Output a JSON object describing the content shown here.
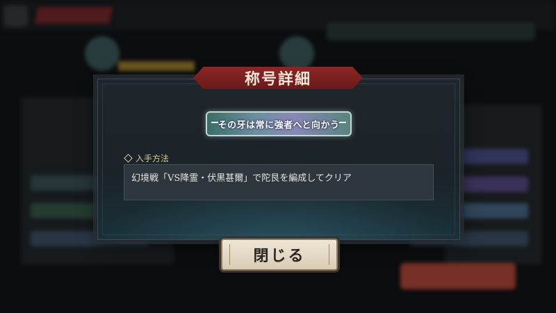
{
  "dialog": {
    "title": "称号詳細",
    "title_plate_text": "その牙は常に強者へと向かう",
    "acquire_label": "入手方法",
    "acquire_text": "幻境戦「VS降霊・伏黒甚爾」で陀艮を編成してクリア",
    "close_label": "閉じる"
  },
  "icons": {
    "acquire_bullet": "diamond-icon"
  },
  "colors": {
    "banner": "#8e2626",
    "accent_text": "#d9c7a0",
    "close_button": "#efe6d6",
    "background_red_button": "#b74a3c"
  }
}
